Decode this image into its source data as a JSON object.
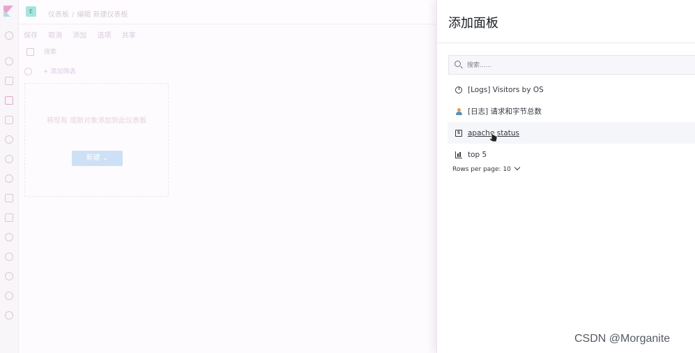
{
  "background_app": {
    "breadcrumb": [
      "仪表板",
      "编辑 新建仪表板"
    ],
    "menu": [
      "保存",
      "取消",
      "添加",
      "选项",
      "共享"
    ],
    "search_placeholder": "搜索",
    "add_filter": "+ 添加筛选",
    "empty_state": "将现有 或新对象添加到此仪表板",
    "new_button": "新建",
    "app_badge": "E"
  },
  "flyout": {
    "title": "添加面板",
    "search_placeholder": "搜索......",
    "items": [
      {
        "label": "[Logs] Visitors by OS",
        "icon": "pie-chart-icon"
      },
      {
        "label": "[日志] 请求和字节总数",
        "icon": "user-metric-icon"
      },
      {
        "label": "apache status",
        "icon": "saved-search-icon"
      },
      {
        "label": "top 5",
        "icon": "bar-chart-icon"
      }
    ],
    "rows_per_page": "Rows per page: 10"
  },
  "watermark": "CSDN @Morganite",
  "colors": {
    "accent_pink": "#e2a6c9",
    "badge_teal": "#a6e6df",
    "button_blue": "#cde0f5",
    "text_dark": "#343741"
  }
}
